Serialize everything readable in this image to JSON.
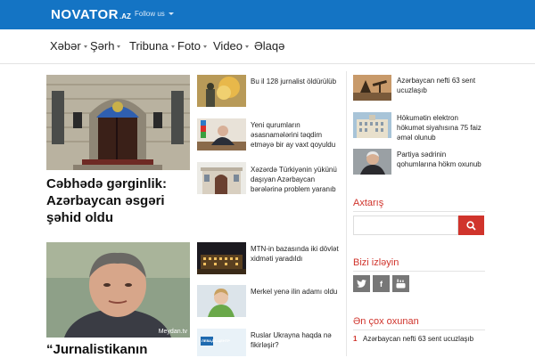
{
  "brand": {
    "name": "NOVATOR",
    "suffix": ".AZ",
    "follow_label": "Follow us"
  },
  "nav": [
    "Xəbər",
    "Şərh",
    "Tribuna",
    "Foto",
    "Video",
    "Əlaqə"
  ],
  "featured": [
    {
      "title_line1": "Cəbhədə gərginlik:",
      "title_line2": "Azərbaycan əsgəri",
      "title_line3": "şəhid oldu"
    },
    {
      "title_line1": "“Jurnalistikanın",
      "watermark": "Meydan.tv"
    }
  ],
  "thumbs": [
    {
      "title_line1": "Bu il 128 jurnalist öldürülüb"
    },
    {
      "title_line1": "Yeni qurumların",
      "title_line2": "əsasnamələrini təqdim",
      "title_line3": "etməyə bir ay vaxt qoyuldu"
    },
    {
      "title_line1": "Xəzərdə Türkiyənin yükünü",
      "title_line2": "daşıyan Azərbaycan",
      "title_line3": "bərələrinə problem yaranıb"
    },
    {
      "title_line1": "MTN-in bazasında iki dövlət",
      "title_line2": "xidməti yaradıldı"
    },
    {
      "title_line1": "Merkel yenə ilin adamı oldu"
    },
    {
      "title_line1": "Ruslar Ukrayna haqda nə",
      "title_line2": "fikirləşir?",
      "img_text": "ЛЕВАДА-ЦЕНТР"
    }
  ],
  "right_news": [
    {
      "title_line1": "Azərbaycan nefti 63 sent",
      "title_line2": "ucuzlaşıb"
    },
    {
      "title_line1": "Hökumətin elektron",
      "title_line2": "hökumət siyahısına 75 faiz",
      "title_line3": "əməl olunub"
    },
    {
      "title_line1": "Partiya sədrinin",
      "title_line2": "qohumlarına hökm oxunub"
    }
  ],
  "search": {
    "heading": "Axtarış",
    "value": ""
  },
  "social": {
    "heading": "Bizi izləyin"
  },
  "popular": {
    "heading": "Ən çox oxunan",
    "items": [
      {
        "num": "1",
        "title": "Azərbaycan nefti 63 sent ucuzlaşıb"
      }
    ]
  },
  "colors": {
    "brand_blue": "#1474c4",
    "accent_red": "#d0342c"
  }
}
